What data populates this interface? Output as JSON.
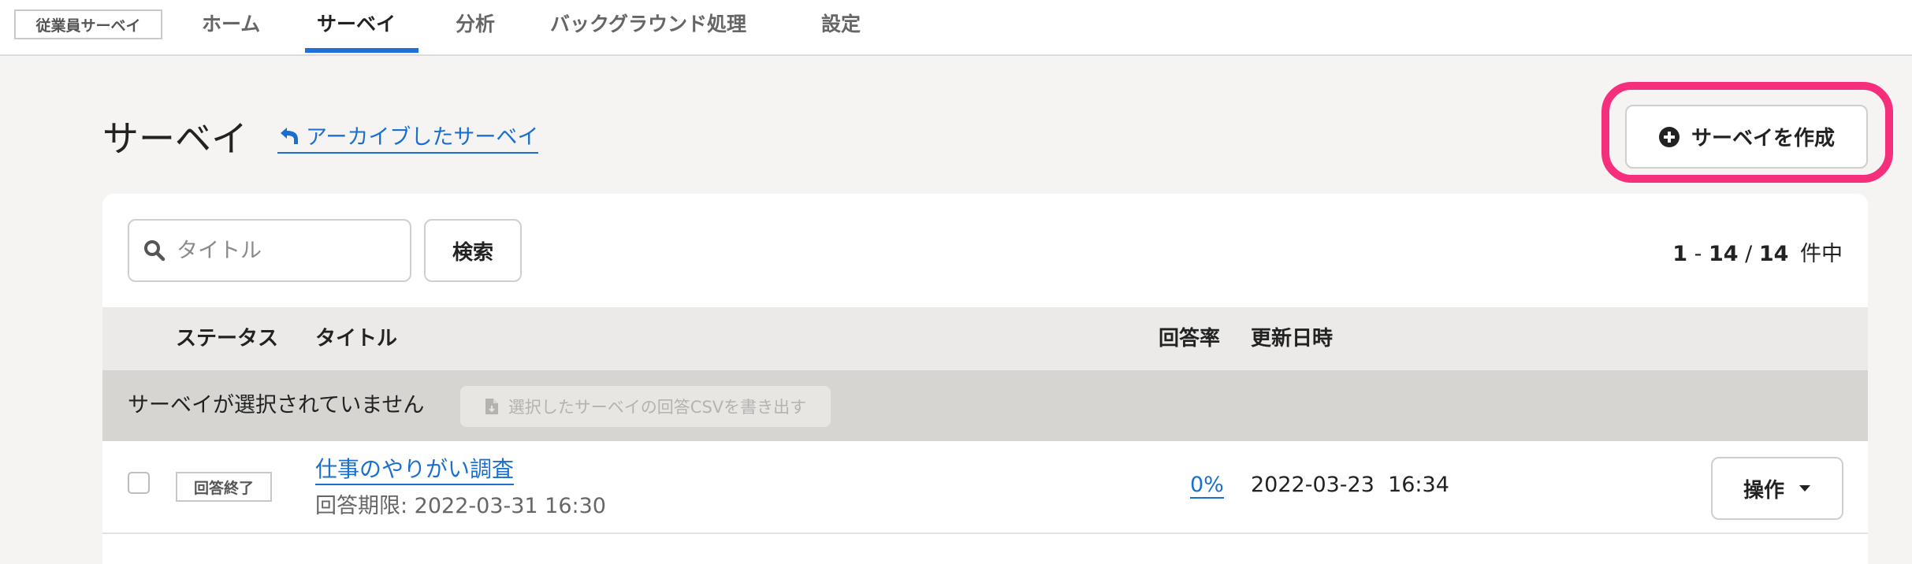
{
  "nav": {
    "brand": "従業員サーベイ",
    "items": [
      {
        "label": "ホーム"
      },
      {
        "label": "サーベイ"
      },
      {
        "label": "分析"
      },
      {
        "label": "バックグラウンド処理"
      },
      {
        "label": "設定"
      }
    ],
    "active": "サーベイ"
  },
  "header": {
    "title": "サーベイ",
    "archive_link": "アーカイブしたサーベイ",
    "create_button": "サーベイを作成"
  },
  "search": {
    "placeholder": "タイトル",
    "value": "",
    "button": "検索"
  },
  "pagination": {
    "range_start": "1",
    "range_end": "14",
    "total": "14",
    "suffix": "件中"
  },
  "table": {
    "columns": [
      "ステータス",
      "タイトル",
      "回答率",
      "更新日時"
    ],
    "selection_message": "サーベイが選択されていません",
    "export_button": "選択したサーベイの回答CSVを書き出す",
    "rows": [
      {
        "status": "回答終了",
        "title": "仕事のやりがい調査",
        "deadline": "回答期限: 2022-03-31 16:30",
        "response_rate": "0%",
        "updated": "2022-03-23  16:34",
        "actions_label": "操作"
      }
    ]
  },
  "colors": {
    "accent": "#1e6fd9",
    "link": "#1a6fcf",
    "highlight": "#f52f7b",
    "background": "#f5f4f2"
  },
  "icons": [
    "search-icon",
    "undo-arrow-icon",
    "plus-circle-icon",
    "file-icon",
    "caret-down-icon"
  ]
}
